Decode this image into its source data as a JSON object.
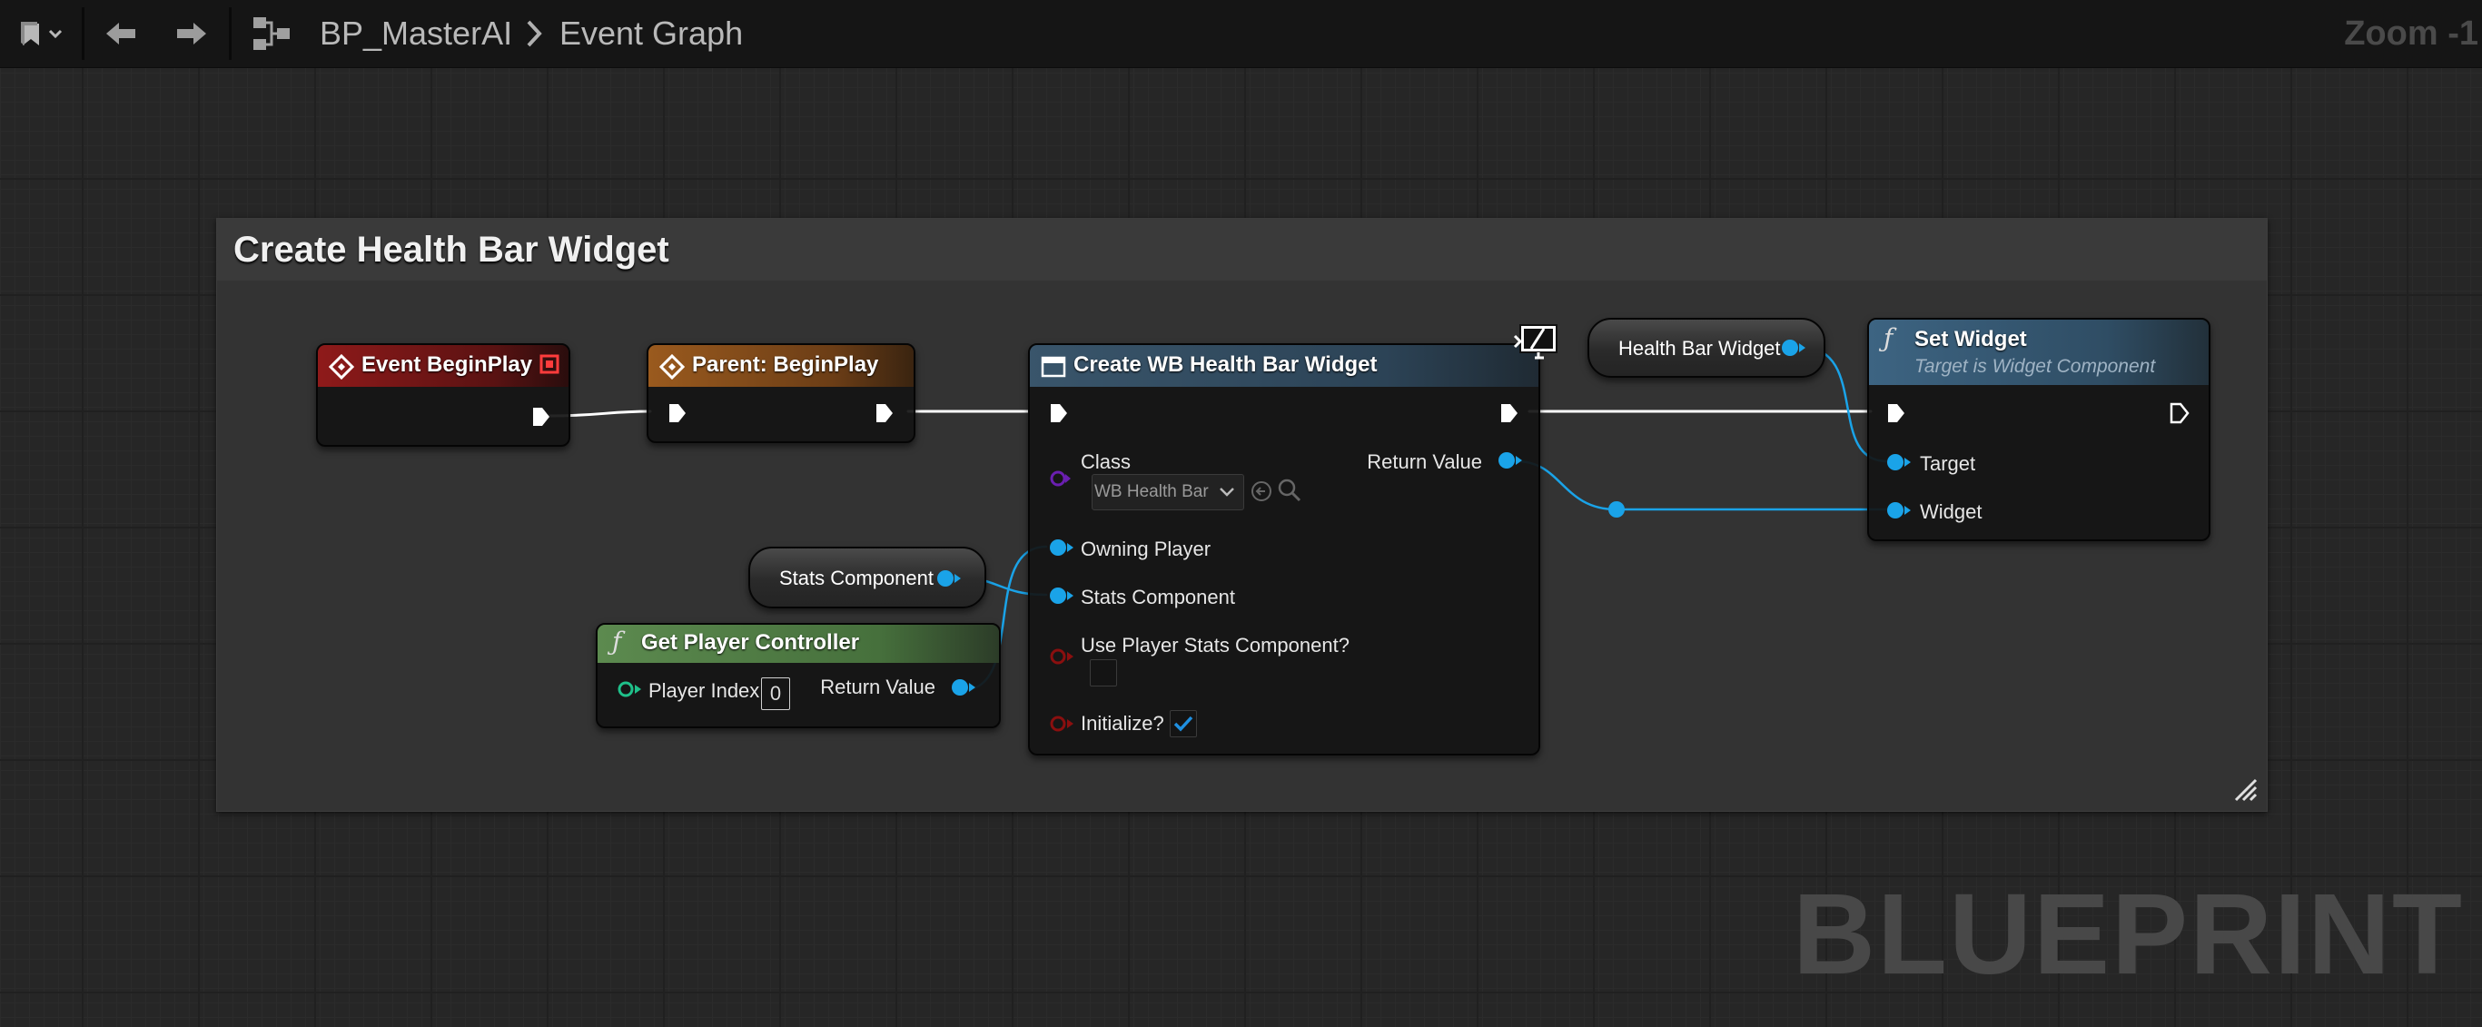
{
  "toolbar": {
    "breadcrumb_asset": "BP_MasterAI",
    "breadcrumb_graph": "Event Graph",
    "zoom": "Zoom -1"
  },
  "comment": {
    "title": "Create Health Bar Widget"
  },
  "nodes": {
    "event_begin_play": {
      "title": "Event BeginPlay"
    },
    "parent_begin_play": {
      "title": "Parent: BeginPlay"
    },
    "create_widget": {
      "title": "Create WB Health Bar Widget",
      "class_label": "Class",
      "class_value": "WB Health Bar",
      "return_value": "Return Value",
      "owning_player": "Owning Player",
      "stats_component": "Stats Component",
      "use_player_stats": "Use Player Stats Component?",
      "use_player_stats_checked": false,
      "initialize": "Initialize?",
      "initialize_checked": true
    },
    "health_bar_widget_var": {
      "label": "Health Bar Widget"
    },
    "set_widget": {
      "title": "Set Widget",
      "subtitle": "Target is Widget Component",
      "target": "Target",
      "widget": "Widget"
    },
    "stats_component_var": {
      "label": "Stats Component"
    },
    "get_player_controller": {
      "title": "Get Player Controller",
      "player_index_label": "Player Index",
      "player_index_value": "0",
      "return_value": "Return Value"
    }
  },
  "watermark": "BLUEPRINT",
  "colors": {
    "event_header": "#8f1a1a",
    "parent_header": "#9a5a1e",
    "create_header": "#39556b",
    "set_header": "#3d6482",
    "pure_header": "#4f7a44",
    "object_pin": "#1aa3e8",
    "class_pin": "#6a1fb0",
    "bool_pin": "#8a0f0f",
    "int_pin": "#1fc08a",
    "exec_pin": "#ffffff"
  }
}
